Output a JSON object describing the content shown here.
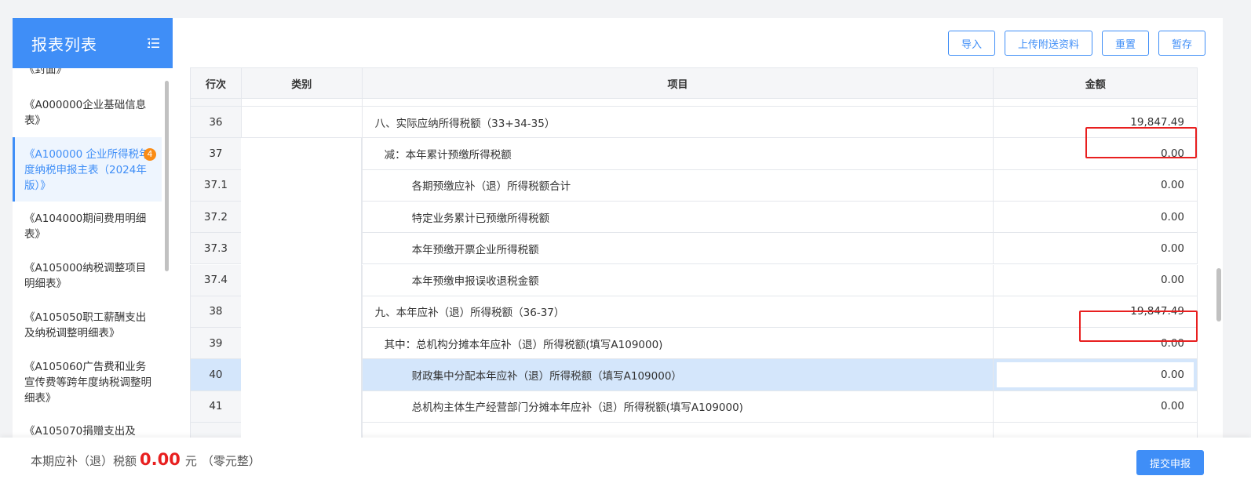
{
  "sidebar": {
    "title": "报表列表",
    "items": [
      {
        "label": "《封面》"
      },
      {
        "label": "《A000000企业基础信息表》"
      },
      {
        "label": "《A100000 企业所得税年度纳税申报主表（2024年版）》",
        "badge": "4",
        "active": true
      },
      {
        "label": "《A104000期间费用明细表》"
      },
      {
        "label": "《A105000纳税调整项目明细表》"
      },
      {
        "label": "《A105050职工薪酬支出及纳税调整明细表》"
      },
      {
        "label": "《A105060广告费和业务宣传费等跨年度纳税调整明细表》"
      },
      {
        "label": "《A105070捐赠支出及"
      }
    ]
  },
  "toolbar": {
    "import_label": "导入",
    "upload_label": "上传附送资料",
    "reset_label": "重置",
    "save_label": "暂存"
  },
  "table": {
    "headers": [
      "行次",
      "类别",
      "项目",
      "金额"
    ],
    "rows": [
      {
        "num": "36",
        "item": "八、实际应纳所得税额（33+34-35）",
        "amount": "19,847.49",
        "indent": 0,
        "highlight": true
      },
      {
        "num": "37",
        "item": "减：本年累计预缴所得税额",
        "amount": "0.00",
        "indent": 1
      },
      {
        "num": "37.1",
        "item": "各期预缴应补（退）所得税额合计",
        "amount": "0.00",
        "indent": 2
      },
      {
        "num": "37.2",
        "item": "特定业务累计已预缴所得税额",
        "amount": "0.00",
        "indent": 2
      },
      {
        "num": "37.3",
        "item": "本年预缴开票企业所得税额",
        "amount": "0.00",
        "indent": 2
      },
      {
        "num": "37.4",
        "item": "本年预缴申报误收退税金额",
        "amount": "0.00",
        "indent": 2
      },
      {
        "num": "38",
        "item": "九、本年应补（退）所得税额（36-37）",
        "amount": "19,847.49",
        "indent": 0,
        "highlight": true
      },
      {
        "num": "39",
        "item": "其中：总机构分摊本年应补（退）所得税额(填写A109000)",
        "amount": "0.00",
        "indent": 1
      },
      {
        "num": "40",
        "item": "财政集中分配本年应补（退）所得税额（填写A109000）",
        "amount": "0.00",
        "indent": 2,
        "selected": true
      },
      {
        "num": "41",
        "item": "总机构主体生产经营部门分摊本年应补（退）所得税额(填写A109000)",
        "amount": "0.00",
        "indent": 2
      }
    ]
  },
  "footer": {
    "label": "本期应补（退）税额",
    "amount": "0.00",
    "unit": "元",
    "uppercase": "（零元整）",
    "submit_label": "提交申报"
  },
  "colors": {
    "primary": "#3f8ef7",
    "highlight_border": "#e81f1f",
    "badge": "#fa8c16",
    "selected_row": "#d4e6fb"
  }
}
